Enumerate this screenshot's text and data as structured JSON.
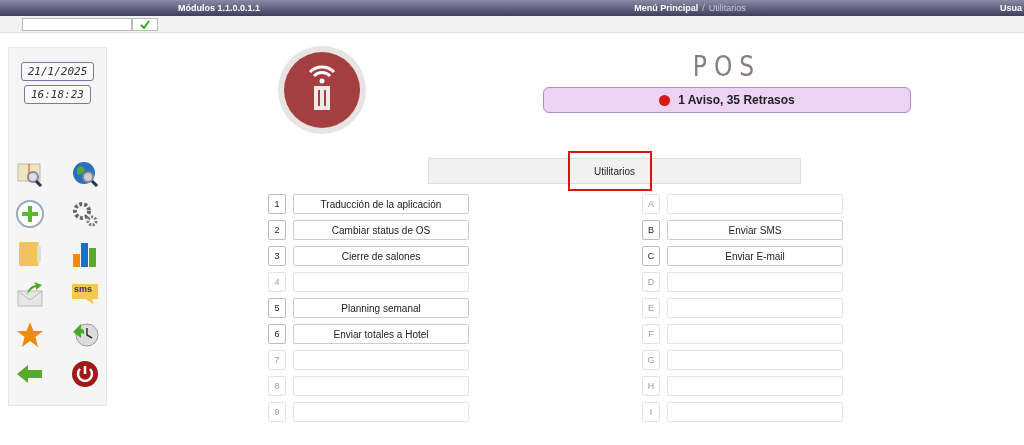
{
  "top_bar": {
    "version": "Módulos 1.1.0.0.1.1",
    "breadcrumb": [
      "Menú Principal",
      "Utilitarios"
    ],
    "separator": "/",
    "user": "Usua"
  },
  "sidebar": {
    "date": "21/1/2025",
    "time": "16:18:23",
    "icons": [
      {
        "kind": "book-search"
      },
      {
        "kind": "globe-search"
      },
      {
        "kind": "add"
      },
      {
        "kind": "gears"
      },
      {
        "kind": "folder"
      },
      {
        "kind": "bar-chart"
      },
      {
        "kind": "mail-send"
      },
      {
        "kind": "sms"
      },
      {
        "kind": "star"
      },
      {
        "kind": "clock-back"
      },
      {
        "kind": "back-arrow"
      },
      {
        "kind": "power"
      }
    ],
    "sms_label": "sms"
  },
  "title": "POS",
  "alert": {
    "text": "1 Aviso, 35 Retrasos",
    "color": "#d81818"
  },
  "section": {
    "title": "Utilitarios",
    "highlighted": true
  },
  "left_items": [
    {
      "key": "1",
      "label": "Traducción de la aplicación",
      "enabled": true
    },
    {
      "key": "2",
      "label": "Cambiar status de OS",
      "enabled": true
    },
    {
      "key": "3",
      "label": "Cierre de salones",
      "enabled": true
    },
    {
      "key": "4",
      "enabled": false
    },
    {
      "key": "5",
      "label": "Planning semanal",
      "enabled": true
    },
    {
      "key": "6",
      "label": "Enviar totales a Hotel",
      "enabled": true
    },
    {
      "key": "7",
      "enabled": false
    },
    {
      "key": "8",
      "enabled": false
    },
    {
      "key": "9",
      "enabled": false
    }
  ],
  "right_items": [
    {
      "key": "A",
      "enabled": false
    },
    {
      "key": "B",
      "label": "Enviar SMS",
      "enabled": true
    },
    {
      "key": "C",
      "label": "Enviar E-mail",
      "enabled": true
    },
    {
      "key": "D",
      "enabled": false
    },
    {
      "key": "E",
      "enabled": false
    },
    {
      "key": "F",
      "enabled": false
    },
    {
      "key": "G",
      "enabled": false
    },
    {
      "key": "H",
      "enabled": false
    },
    {
      "key": "I",
      "enabled": false
    }
  ]
}
